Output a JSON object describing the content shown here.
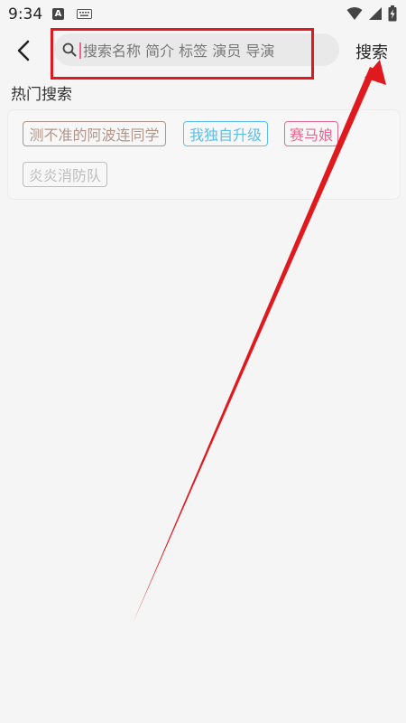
{
  "status_bar": {
    "time": "9:34",
    "notification_badge": "A",
    "icons": [
      "keyboard-icon",
      "wifi-icon",
      "signal-icon",
      "battery-charging-icon"
    ]
  },
  "header": {
    "back_icon": "chevron-left-icon",
    "search": {
      "icon": "search-icon",
      "placeholder": "搜索名称 简介 标签 演员 导演",
      "value": ""
    },
    "search_button_label": "搜索"
  },
  "hot_search": {
    "title": "热门搜索",
    "tags": [
      {
        "label": "测不准的阿波连同学",
        "color": "#b0958a"
      },
      {
        "label": "我独自升级",
        "color": "#5bc0e8"
      },
      {
        "label": "赛马娘",
        "color": "#e46a94"
      },
      {
        "label": "炎炎消防队",
        "color": "#bdbdbd"
      }
    ]
  },
  "annotation": {
    "highlight_color": "#e0191e"
  }
}
